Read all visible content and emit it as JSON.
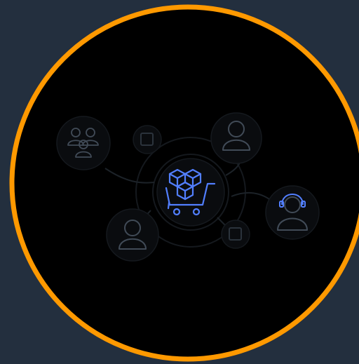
{
  "colors": {
    "page_background": "#232f3e",
    "circle_fill": "#000000",
    "circle_ring": "#ff9900",
    "accent_icon": "#527fff",
    "muted_icon": "#414b57",
    "faint_ring": "#161a1f",
    "connector": "#1e242b"
  },
  "icons": {
    "center": "shopping-cart-with-boxes-icon",
    "group": "user-group-icon",
    "user_top": "user-icon",
    "user_bottom": "user-icon",
    "support": "headset-agent-icon",
    "small_square_top": "square-node-icon",
    "small_square_bottom": "square-node-icon"
  }
}
